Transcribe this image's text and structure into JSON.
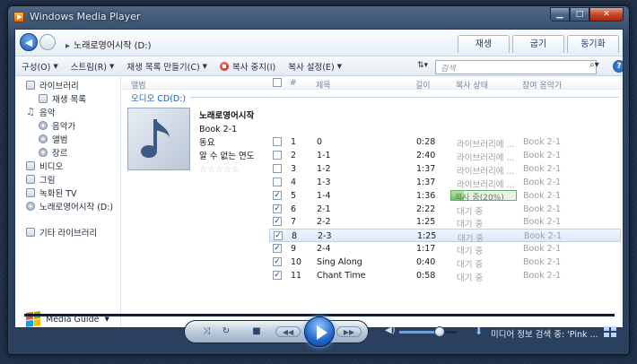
{
  "window": {
    "title": "Windows Media Player"
  },
  "nav": {
    "breadcrumb": "노래로영어시작 (D:)"
  },
  "tabs": [
    {
      "label": "재생"
    },
    {
      "label": "굽기"
    },
    {
      "label": "동기화"
    }
  ],
  "toolbar": {
    "organize": "구성(O)",
    "stream": "스트림(R)",
    "create_playlist": "재생 목록 만들기(C)",
    "stop_rip": "복사 중지(I)",
    "rip_settings": "복사 설정(E)",
    "search_placeholder": "검색"
  },
  "sidebar": {
    "items": [
      {
        "label": "라이브러리",
        "icon": "library-icon",
        "indent": 0
      },
      {
        "label": "재생 목록",
        "icon": "playlist-icon",
        "indent": 1
      },
      {
        "label": "음악",
        "icon": "music-note-icon",
        "indent": 0
      },
      {
        "label": "음악가",
        "icon": "artist-icon",
        "indent": 1
      },
      {
        "label": "앨범",
        "icon": "album-icon",
        "indent": 1
      },
      {
        "label": "장르",
        "icon": "genre-icon",
        "indent": 1
      },
      {
        "label": "비디오",
        "icon": "video-icon",
        "indent": 0
      },
      {
        "label": "그림",
        "icon": "picture-icon",
        "indent": 0
      },
      {
        "label": "녹화된 TV",
        "icon": "tv-icon",
        "indent": 0
      },
      {
        "label": "노래로영어시작 (D:)",
        "icon": "cd-drive-icon",
        "indent": 0
      },
      {
        "label": "기타 라이브러리",
        "icon": "other-libraries-icon",
        "indent": 0
      }
    ],
    "media_guide": "Media Guide"
  },
  "columns": {
    "album": "앨범",
    "number": "#",
    "title": "제목",
    "length": "길이",
    "rip_status": "복사 상태",
    "contributing_artist": "참여 음악가"
  },
  "group_title": "오디오 CD(D:)",
  "album": {
    "title": "노래로영어시작",
    "artist": "Book 2-1",
    "genre": "동요",
    "year": "알 수 없는 연도",
    "stars": "☆☆☆☆☆"
  },
  "tracks": [
    {
      "checked": false,
      "number": "1",
      "title": "0",
      "length": "0:28",
      "status": "라이브러리에 ...",
      "artist": "Book 2-1"
    },
    {
      "checked": false,
      "number": "2",
      "title": "1-1",
      "length": "2:40",
      "status": "라이브러리에 ...",
      "artist": "Book 2-1"
    },
    {
      "checked": false,
      "number": "3",
      "title": "1-2",
      "length": "1:37",
      "status": "라이브러리에 ...",
      "artist": "Book 2-1"
    },
    {
      "checked": false,
      "number": "4",
      "title": "1-3",
      "length": "1:37",
      "status": "라이브러리에 ...",
      "artist": "Book 2-1"
    },
    {
      "checked": true,
      "number": "5",
      "title": "1-4",
      "length": "1:36",
      "status": "복사 중(20%)",
      "progress": 0.2,
      "artist": "Book 2-1"
    },
    {
      "checked": true,
      "number": "6",
      "title": "2-1",
      "length": "2:22",
      "status": "대기 중",
      "artist": "Book 2-1"
    },
    {
      "checked": true,
      "number": "7",
      "title": "2-2",
      "length": "1:25",
      "status": "대기 중",
      "artist": "Book 2-1"
    },
    {
      "checked": true,
      "number": "8",
      "title": "2-3",
      "length": "1:25",
      "status": "대기 중",
      "artist": "Book 2-1",
      "selected": true
    },
    {
      "checked": true,
      "number": "9",
      "title": "2-4",
      "length": "1:17",
      "status": "대기 중",
      "artist": "Book 2-1"
    },
    {
      "checked": true,
      "number": "10",
      "title": "Sing Along",
      "length": "0:40",
      "status": "대기 중",
      "artist": "Book 2-1"
    },
    {
      "checked": true,
      "number": "11",
      "title": "Chant Time",
      "length": "0:58",
      "status": "대기 중",
      "artist": "Book 2-1"
    }
  ],
  "player": {
    "volume": 0.7,
    "status_text": "미디어 정보 검색 중: 'Pink ..."
  }
}
